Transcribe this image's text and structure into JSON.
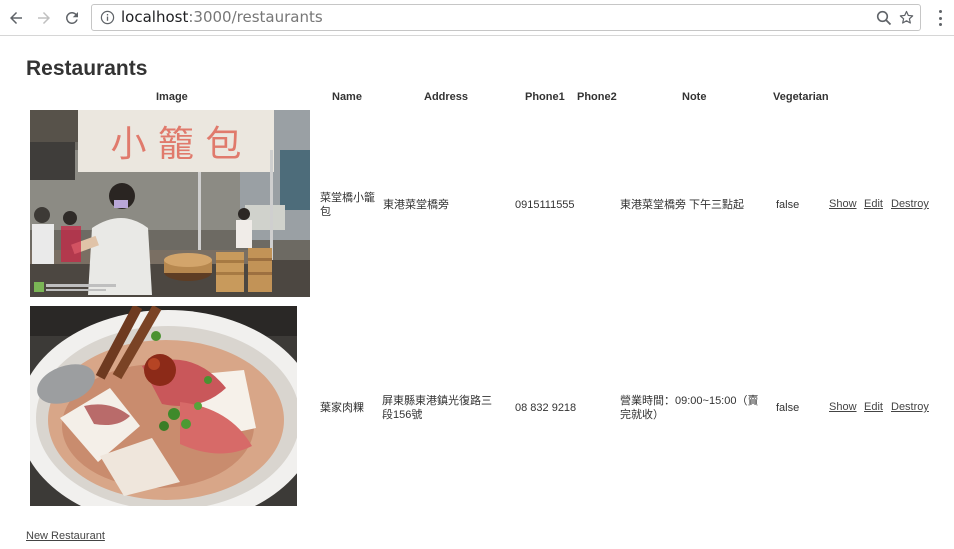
{
  "browser": {
    "url_host": "localhost",
    "url_path": ":3000/restaurants"
  },
  "page": {
    "title": "Restaurants",
    "new_link": "New Restaurant"
  },
  "table": {
    "headers": [
      "Image",
      "Name",
      "Address",
      "Phone1",
      "Phone2",
      "Note",
      "Vegetarian"
    ],
    "rows": [
      {
        "name": "菜堂橋小籠包",
        "address": "東港菜堂橋旁",
        "phone1": "0915111555",
        "phone2": "",
        "note": "東港菜堂橋旁 下午三點起",
        "vegetarian": "false",
        "show": "Show",
        "edit": "Edit",
        "destroy": "Destroy",
        "image_sign": "小 籠 包"
      },
      {
        "name": "葉家肉粿",
        "address": "屏東縣東港鎮光復路三段156號",
        "phone1": "08 832 9218",
        "phone2": "",
        "note": "營業時間：09:00~15:00（賣完就收）",
        "vegetarian": "false",
        "show": "Show",
        "edit": "Edit",
        "destroy": "Destroy"
      }
    ]
  },
  "icons": {
    "back": "back-arrow-icon",
    "forward": "forward-arrow-icon",
    "reload": "reload-icon",
    "info": "info-icon",
    "zoom": "zoom-icon",
    "star": "star-icon",
    "menu": "menu-icon"
  }
}
